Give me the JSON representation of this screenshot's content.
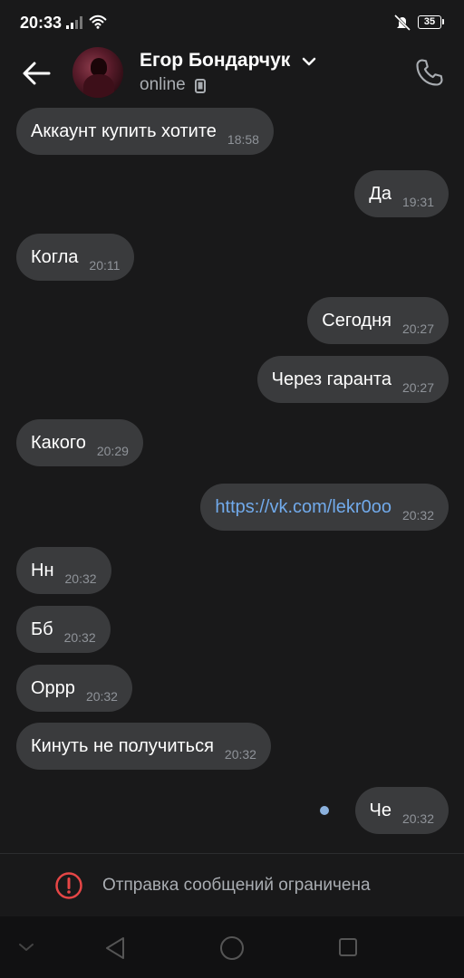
{
  "status_bar": {
    "time": "20:33",
    "battery": "35"
  },
  "header": {
    "name": "Егор Бондарчук",
    "status": "online"
  },
  "messages": [
    {
      "text": "Аккаунт купить хотите",
      "time": "18:58",
      "side": "in"
    },
    {
      "text": "Да",
      "time": "19:31",
      "side": "out"
    },
    {
      "text": "Когла",
      "time": "20:11",
      "side": "in"
    },
    {
      "text": "Сегодня",
      "time": "20:27",
      "side": "out"
    },
    {
      "text": "Через гаранта",
      "time": "20:27",
      "side": "out"
    },
    {
      "text": "Какого",
      "time": "20:29",
      "side": "in"
    },
    {
      "text": "https://vk.com/lekr0oo",
      "time": "20:32",
      "side": "out",
      "link": true
    },
    {
      "text": "Нн",
      "time": "20:32",
      "side": "in"
    },
    {
      "text": "Бб",
      "time": "20:32",
      "side": "in"
    },
    {
      "text": "Оррр",
      "time": "20:32",
      "side": "in"
    },
    {
      "text": "Кинуть не получиться",
      "time": "20:32",
      "side": "in"
    },
    {
      "text": "Че",
      "time": "20:32",
      "side": "out"
    }
  ],
  "restricted": {
    "text": "Отправка сообщений ограничена"
  },
  "colors": {
    "background": "#19191a",
    "bubble": "#3a3b3d",
    "link": "#71aaeb",
    "warning": "#e64646"
  }
}
